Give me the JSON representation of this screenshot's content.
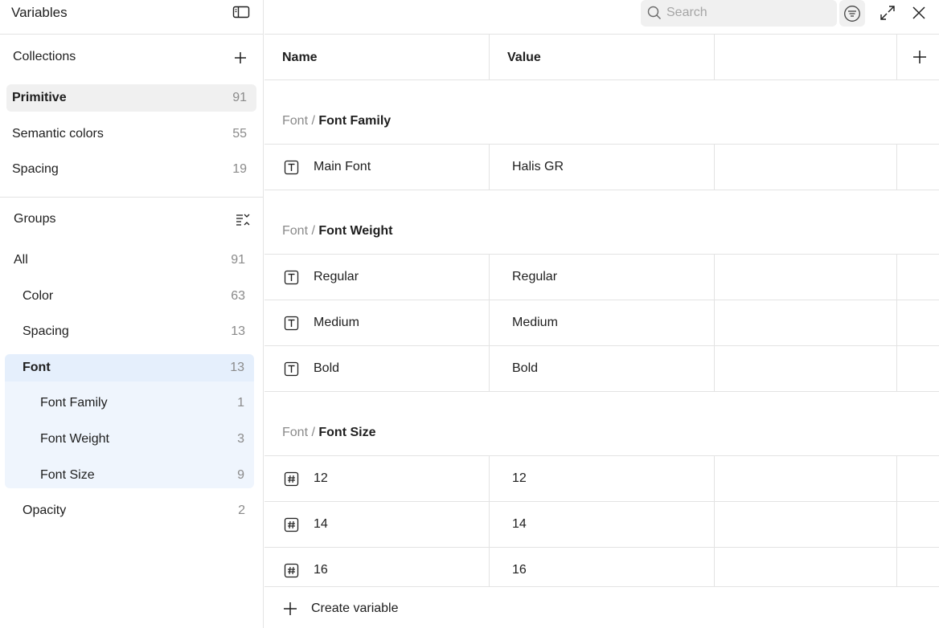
{
  "sidebar": {
    "title": "Variables",
    "toggle_icon": "sidebar-toggle-icon",
    "collections": {
      "label": "Collections",
      "add_icon": "plus-icon",
      "items": [
        {
          "label": "Primitive",
          "count": "91"
        },
        {
          "label": "Semantic colors",
          "count": "55"
        },
        {
          "label": "Spacing",
          "count": "19"
        }
      ]
    },
    "groups": {
      "label": "Groups",
      "collapse_icon": "collapse-list-icon",
      "items": [
        {
          "label": "All",
          "count": "91"
        },
        {
          "label": "Color",
          "count": "63"
        },
        {
          "label": "Spacing",
          "count": "13"
        },
        {
          "label": "Font",
          "count": "13"
        },
        {
          "label": "Font Family",
          "count": "1"
        },
        {
          "label": "Font Weight",
          "count": "3"
        },
        {
          "label": "Font Size",
          "count": "9"
        },
        {
          "label": "Opacity",
          "count": "2"
        }
      ]
    }
  },
  "toolbar": {
    "search_placeholder": "Search",
    "filter_icon": "filter-icon",
    "expand_icon": "expand-icon",
    "close_icon": "close-icon"
  },
  "table": {
    "columns": [
      "Name",
      "Value"
    ],
    "add_column_icon": "plus-icon",
    "groups": [
      {
        "path_prefix": "Font",
        "separator": "/",
        "path_name": "Font Family",
        "rows": [
          {
            "type_icon": "text-type-icon",
            "name": "Main Font",
            "value": "Halis GR"
          }
        ]
      },
      {
        "path_prefix": "Font",
        "separator": "/",
        "path_name": "Font Weight",
        "rows": [
          {
            "type_icon": "text-type-icon",
            "name": "Regular",
            "value": "Regular"
          },
          {
            "type_icon": "text-type-icon",
            "name": "Medium",
            "value": "Medium"
          },
          {
            "type_icon": "text-type-icon",
            "name": "Bold",
            "value": "Bold"
          }
        ]
      },
      {
        "path_prefix": "Font",
        "separator": "/",
        "path_name": "Font Size",
        "rows": [
          {
            "type_icon": "number-type-icon",
            "name": "12",
            "value": "12"
          },
          {
            "type_icon": "number-type-icon",
            "name": "14",
            "value": "14"
          },
          {
            "type_icon": "number-type-icon",
            "name": "16",
            "value": "16"
          }
        ]
      }
    ]
  },
  "footer": {
    "create_label": "Create variable"
  }
}
